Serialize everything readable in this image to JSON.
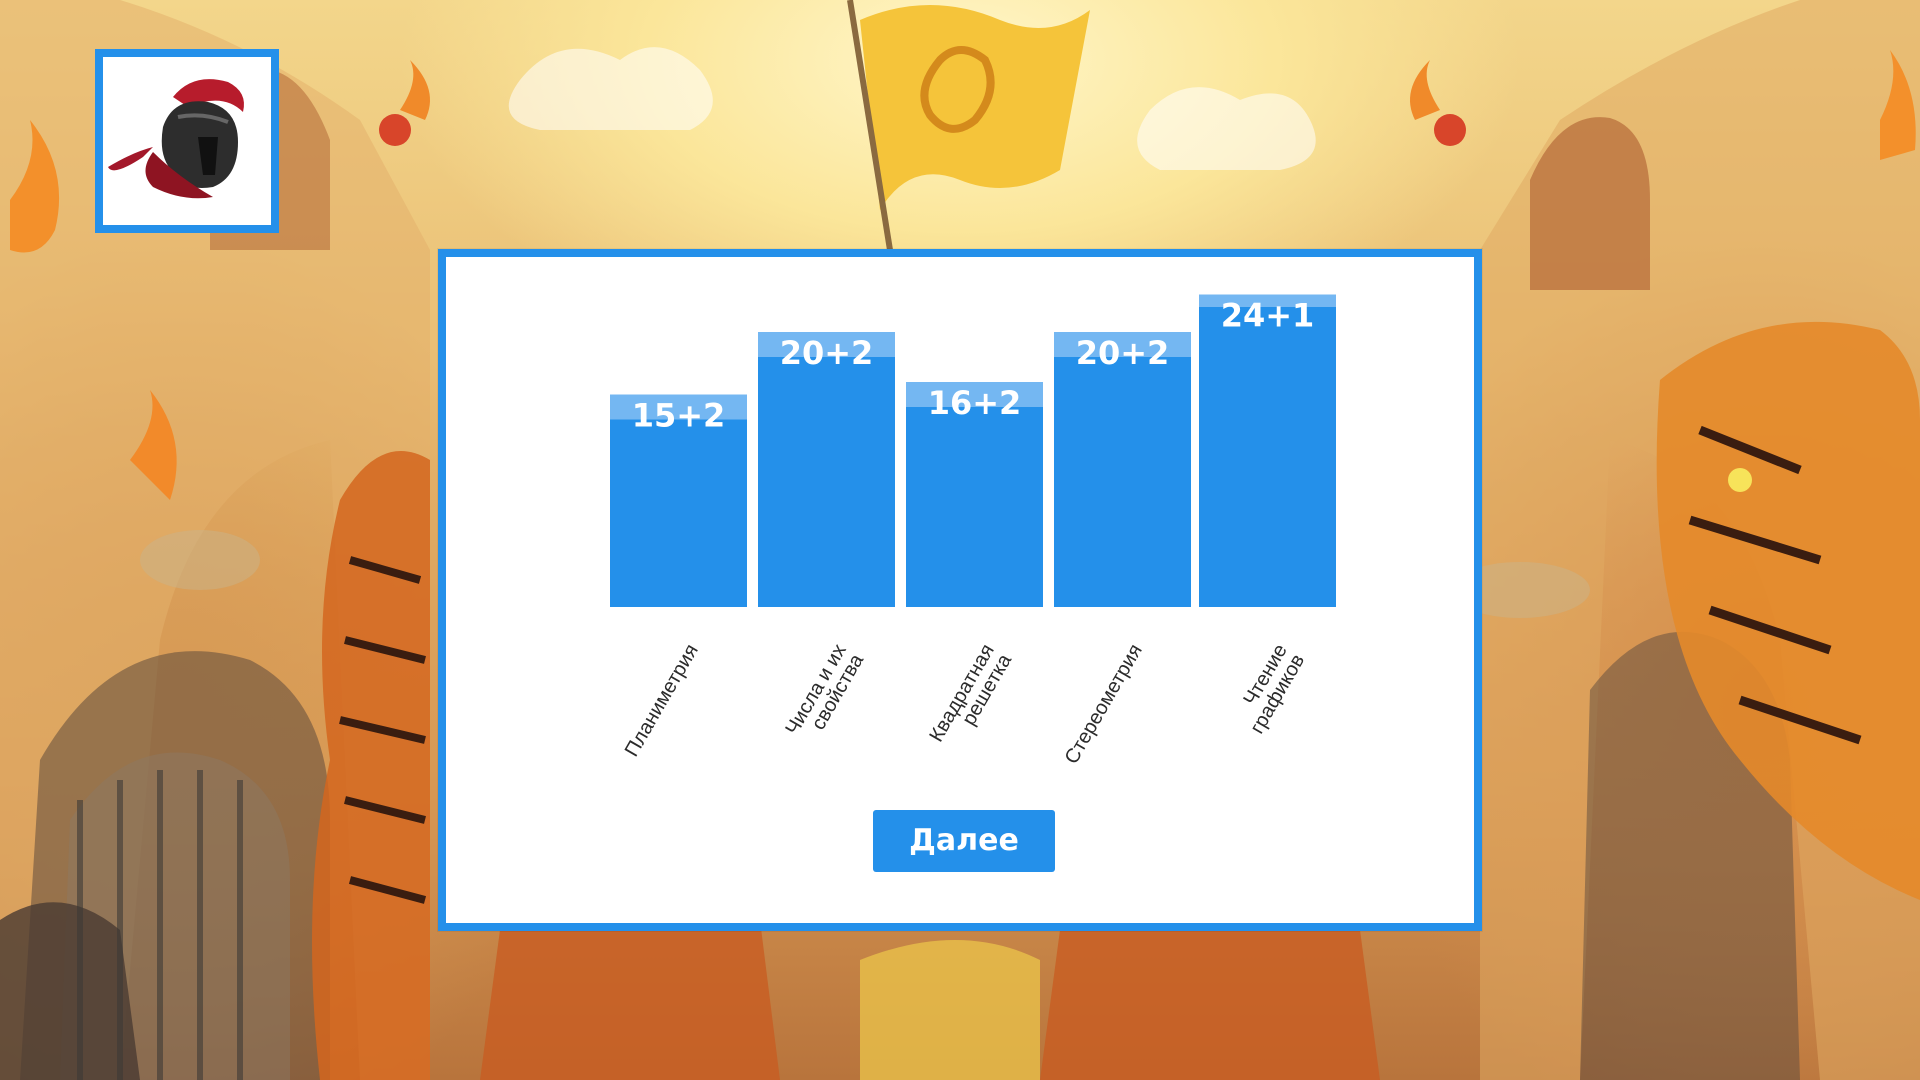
{
  "actions": {
    "next_label": "Далее"
  },
  "chart_data": {
    "type": "bar",
    "categories": [
      "Планиметрия",
      "Числа и их свойства",
      "Квадратная решетка",
      "Стереометрия",
      "Чтение графиков"
    ],
    "category_lines": [
      [
        "Планиметрия"
      ],
      [
        "Числа и их",
        "свойства"
      ],
      [
        "Квадратная",
        "решетка"
      ],
      [
        "Стереометрия"
      ],
      [
        "Чтение",
        "графиков"
      ]
    ],
    "bar_labels": [
      "15+2",
      "20+2",
      "16+2",
      "20+2",
      "24+1"
    ],
    "series": [
      {
        "values": [
          15,
          20,
          16,
          20,
          24
        ]
      },
      {
        "values": [
          2,
          2,
          2,
          2,
          1
        ]
      }
    ],
    "stacked": true,
    "ylim": [
      0,
      25
    ],
    "grid": false,
    "colors": {
      "base": "#2490ea",
      "extra": "#74b7f2",
      "label": "#ffffff"
    }
  },
  "theme": {
    "accent": "#2490ea"
  }
}
